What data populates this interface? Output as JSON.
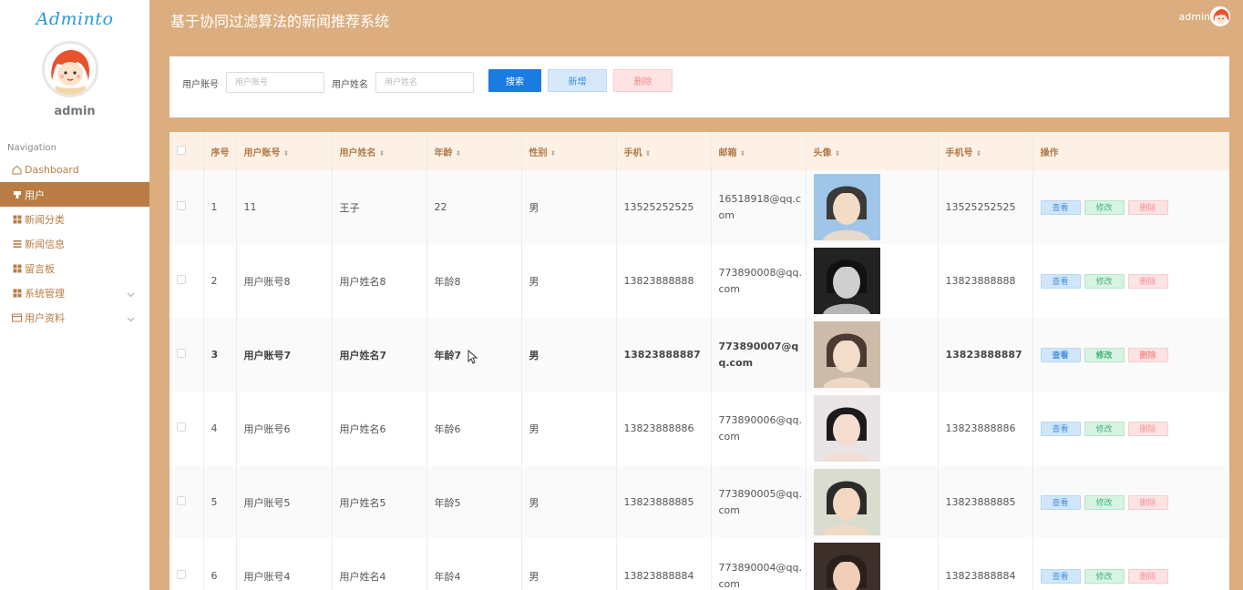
{
  "app": {
    "logo": "Adminto",
    "title": "基于协同过滤算法的新闻推荐系统",
    "user": "admin"
  },
  "sidebar": {
    "username": "admin",
    "nav_title": "Navigation",
    "items": [
      {
        "label": "Dashboard",
        "icon": "home-icon"
      },
      {
        "label": "用户",
        "icon": "user-icon",
        "active": true
      },
      {
        "label": "新闻分类",
        "icon": "grid-icon"
      },
      {
        "label": "新闻信息",
        "icon": "list-icon"
      },
      {
        "label": "留言板",
        "icon": "grid-icon"
      },
      {
        "label": "系统管理",
        "icon": "grid-icon",
        "chevron": true
      },
      {
        "label": "用户资料",
        "icon": "card-icon",
        "chevron": true
      }
    ]
  },
  "search": {
    "account_label": "用户账号",
    "account_placeholder": "用户账号",
    "name_label": "用户姓名",
    "name_placeholder": "用户姓名",
    "search_btn": "搜索",
    "add_btn": "新增",
    "delete_btn": "删除"
  },
  "table": {
    "headers": [
      "序号",
      "用户账号",
      "用户姓名",
      "年龄",
      "性别",
      "手机",
      "邮箱",
      "头像",
      "手机号",
      "操作"
    ],
    "ops": {
      "view": "查看",
      "edit": "修改",
      "delete": "删除"
    },
    "rows": [
      {
        "no": "1",
        "account": "11",
        "name": "王子",
        "age": "22",
        "gender": "男",
        "mobile": "13525252525",
        "email": "16518918@qq.com",
        "phone": "13525252525"
      },
      {
        "no": "2",
        "account": "用户账号8",
        "name": "用户姓名8",
        "age": "年龄8",
        "gender": "男",
        "mobile": "13823888888",
        "email": "773890008@qq.com",
        "phone": "13823888888"
      },
      {
        "no": "3",
        "account": "用户账号7",
        "name": "用户姓名7",
        "age": "年龄7",
        "gender": "男",
        "mobile": "13823888887",
        "email": "773890007@qq.com",
        "phone": "13823888887"
      },
      {
        "no": "4",
        "account": "用户账号6",
        "name": "用户姓名6",
        "age": "年龄6",
        "gender": "男",
        "mobile": "13823888886",
        "email": "773890006@qq.com",
        "phone": "13823888886"
      },
      {
        "no": "5",
        "account": "用户账号5",
        "name": "用户姓名5",
        "age": "年龄5",
        "gender": "男",
        "mobile": "13823888885",
        "email": "773890005@qq.com",
        "phone": "13823888885"
      },
      {
        "no": "6",
        "account": "用户账号4",
        "name": "用户姓名4",
        "age": "年龄4",
        "gender": "男",
        "mobile": "13823888884",
        "email": "773890004@qq.com",
        "phone": "13823888884"
      }
    ]
  },
  "colors": {
    "accent": "#b97c44",
    "page_bg": "#dcae7f",
    "primary": "#1a7be0"
  }
}
